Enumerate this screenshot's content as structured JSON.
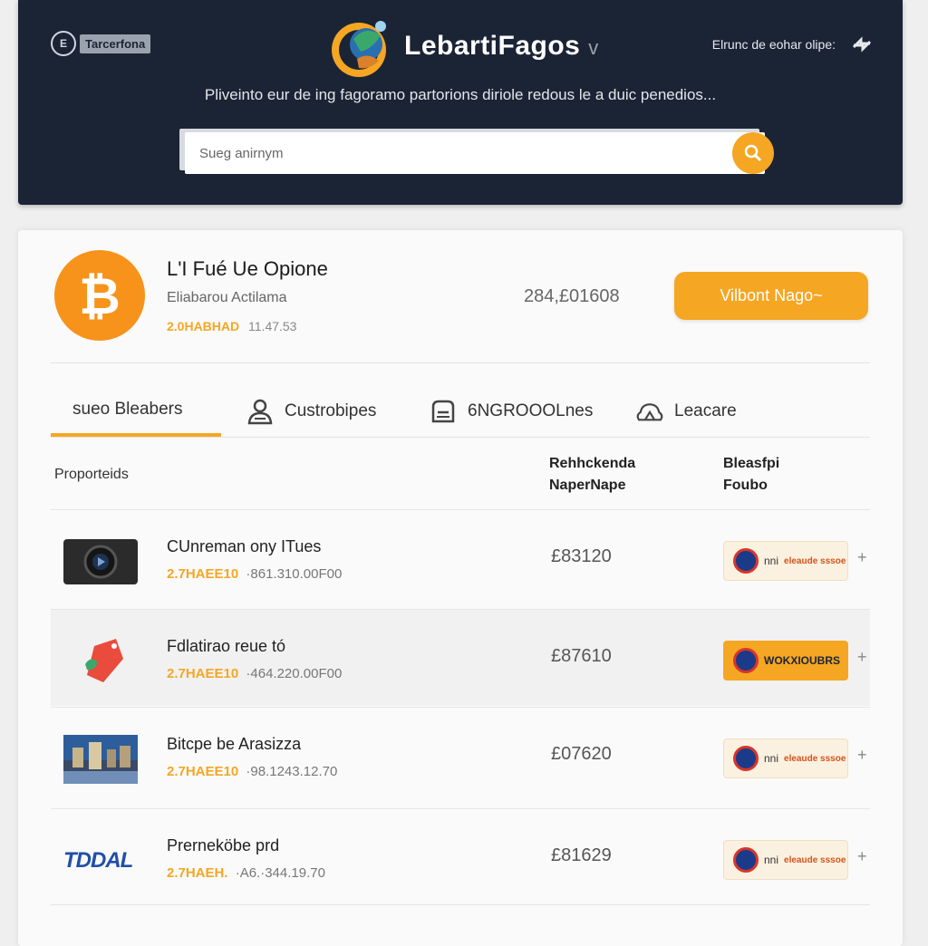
{
  "header": {
    "brand_tag": "Tarcerfona",
    "brand_coin": "E",
    "logo_text": "LebartiFagos",
    "logo_suffix": "v",
    "right_text": "Elrunc de eohar olipe:",
    "tagline": "Pliveinto eur de ing fagoramo partorions diriole redous le a duic penedios...",
    "search_placeholder": "Sueg anirnym"
  },
  "summary": {
    "title": "L'I Fué Ue Opione",
    "subtitle": "Eliabarou Actilama",
    "meta_orange": "2.0HABHAD",
    "meta_grey": "11.47.53",
    "value": "284,£01608",
    "button_label": "Vilbont Nago~"
  },
  "tabs": [
    {
      "label": "sueo Bleabers",
      "icon": "none"
    },
    {
      "label": "Custrobipes",
      "icon": "user-group-icon"
    },
    {
      "label": "6NGROOOLnes",
      "icon": "calculator-icon"
    },
    {
      "label": "Leacare",
      "icon": "cloud-icon"
    }
  ],
  "table": {
    "headers": {
      "col1": "Proporteids",
      "col2_line1": "Rehhckenda",
      "col2_line2": "NaperNape",
      "col3_line1": "Bleasfpi",
      "col3_line2": "Foubo"
    },
    "rows": [
      {
        "name": "CUnreman ony ITues",
        "meta_orange": "2.7HAEE10",
        "meta_grey": "·861.310.00F00",
        "price": "£83120",
        "thumb": "video-camera-icon",
        "action_label": "nni",
        "action_sub": "eleaude sssoe",
        "action_style": "soft"
      },
      {
        "name": "Fdlatirao reue tó",
        "meta_orange": "2.7HAEE10",
        "meta_grey": "·464.220.00F00",
        "price": "£87610",
        "thumb": "price-tag-icon",
        "action_label": "WOKXIOUBRS",
        "action_sub": "",
        "action_style": "solid"
      },
      {
        "name": "Bitcpe be Arasizza",
        "meta_orange": "2.7HAEE10",
        "meta_grey": "·98.1243.12.70",
        "price": "£07620",
        "thumb": "city-image-icon",
        "action_label": "nni",
        "action_sub": "eleaude sssoe",
        "action_style": "soft"
      },
      {
        "name": "Prerneköbe prd",
        "meta_orange": "2.7HAEH.",
        "meta_grey": "·A6.·344.19.70",
        "price": "£81629",
        "thumb": "tdmal-logo",
        "action_label": "nni",
        "action_sub": "eleaude sssoe",
        "action_style": "soft"
      }
    ]
  },
  "colors": {
    "header_bg": "#1b2435",
    "accent": "#f5a623",
    "bitcoin": "#f7931a"
  },
  "tdmal_logo_text": "TDDAL"
}
